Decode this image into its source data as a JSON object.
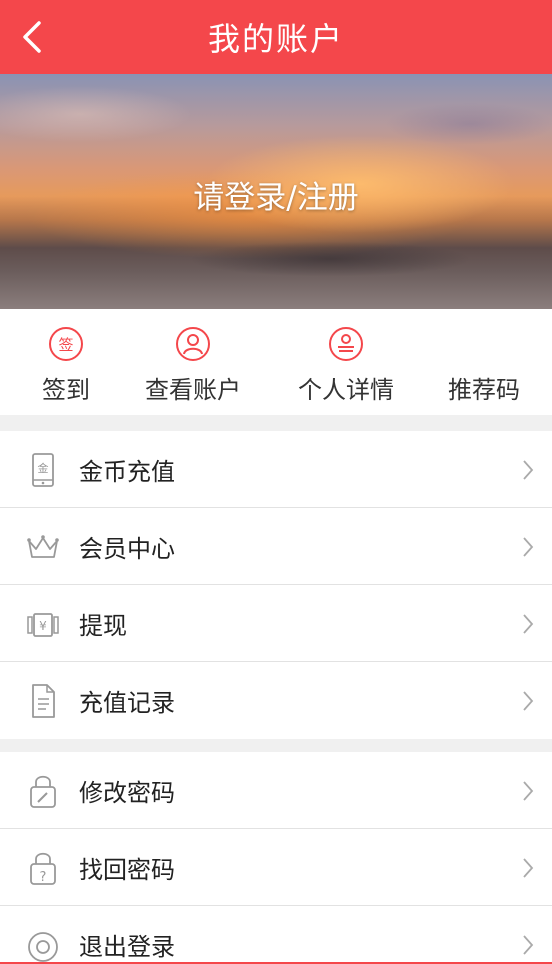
{
  "header": {
    "title": "我的账户"
  },
  "banner": {
    "login_text": "请登录/注册"
  },
  "quick_actions": [
    {
      "label": "签到",
      "icon": "sign-in-icon"
    },
    {
      "label": "查看账户",
      "icon": "user-icon"
    },
    {
      "label": "个人详情",
      "icon": "profile-icon"
    },
    {
      "label": "推荐码",
      "icon": ""
    }
  ],
  "menu_group1": [
    {
      "label": "金币充值",
      "icon": "coin-phone-icon"
    },
    {
      "label": "会员中心",
      "icon": "crown-icon"
    },
    {
      "label": "提现",
      "icon": "withdraw-icon"
    },
    {
      "label": "充值记录",
      "icon": "record-icon"
    }
  ],
  "menu_group2": [
    {
      "label": "修改密码",
      "icon": "lock-edit-icon"
    },
    {
      "label": "找回密码",
      "icon": "lock-question-icon"
    },
    {
      "label": "退出登录",
      "icon": "power-icon"
    }
  ],
  "colors": {
    "accent": "#f4474b",
    "background": "#f0f0f0"
  }
}
